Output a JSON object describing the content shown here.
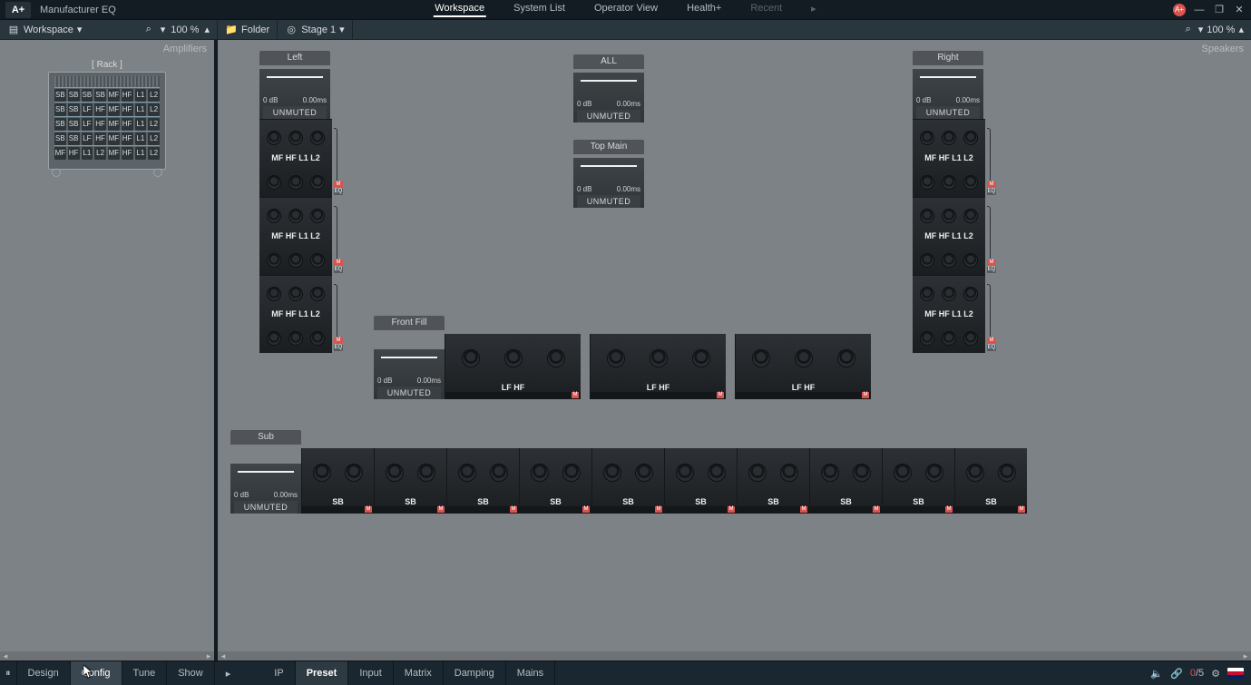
{
  "app": {
    "logo": "A+",
    "name": "Manufacturer EQ"
  },
  "topTabs": {
    "items": [
      "Workspace",
      "System List",
      "Operator View",
      "Health+",
      "Recent"
    ],
    "activeIndex": 0,
    "disabledIndex": 4
  },
  "windowIcons": {
    "badge": "A+",
    "min": "—",
    "restore": "❐",
    "close": "✕",
    "play": "▸"
  },
  "toolbar": {
    "left": {
      "icon": "▤",
      "label": "Workspace",
      "chevron": "▾",
      "search": "⌕",
      "zoomChevron": "▾",
      "zoom": "100 %",
      "zoomArrow": "▴"
    },
    "folder": {
      "icon": "📁",
      "label": "Folder"
    },
    "stage": {
      "icon": "◎",
      "label": "Stage 1",
      "chevron": "▾"
    },
    "right": {
      "search": "⌕",
      "zoomChevron": "▾",
      "zoom": "100 %",
      "zoomArrow": "▴"
    }
  },
  "sidePanel": {
    "title": "Amplifiers"
  },
  "mainPanel": {
    "title": "Speakers"
  },
  "rack": {
    "label": "[ Rack ]",
    "rows": [
      [],
      [
        "SB",
        "SB",
        "SB",
        "SB",
        "MF",
        "HF",
        "L1",
        "L2"
      ],
      [
        "SB",
        "SB",
        "LF",
        "HF",
        "MF",
        "HF",
        "L1",
        "L2"
      ],
      [
        "SB",
        "SB",
        "LF",
        "HF",
        "MF",
        "HF",
        "L1",
        "L2"
      ],
      [
        "SB",
        "SB",
        "LF",
        "HF",
        "MF",
        "HF",
        "L1",
        "L2"
      ],
      [
        "MF",
        "HF",
        "L1",
        "L2",
        "MF",
        "HF",
        "L1",
        "L2"
      ]
    ]
  },
  "groups": {
    "left": {
      "title": "Left",
      "gain": "0 dB",
      "delay": "0.00ms",
      "status": "UNMUTED",
      "modules": [
        "MF HF L1 L2",
        "MF HF L1 L2",
        "MF HF L1 L2"
      ]
    },
    "right": {
      "title": "Right",
      "gain": "0 dB",
      "delay": "0.00ms",
      "status": "UNMUTED",
      "modules": [
        "MF HF L1 L2",
        "MF HF L1 L2",
        "MF HF L1 L2"
      ]
    },
    "all": {
      "title": "ALL",
      "gain": "0 dB",
      "delay": "0.00ms",
      "status": "UNMUTED"
    },
    "topmain": {
      "title": "Top Main",
      "gain": "0 dB",
      "delay": "0.00ms",
      "status": "UNMUTED"
    },
    "frontfill": {
      "title": "Front Fill",
      "gain": "0 dB",
      "delay": "0.00ms",
      "status": "UNMUTED",
      "units": [
        "LF HF",
        "LF HF",
        "LF HF"
      ]
    },
    "sub": {
      "title": "Sub",
      "gain": "0 dB",
      "delay": "0.00ms",
      "status": "UNMUTED",
      "units": [
        "SB",
        "SB",
        "SB",
        "SB",
        "SB",
        "SB",
        "SB",
        "SB",
        "SB",
        "SB"
      ]
    }
  },
  "badges": {
    "m": "M",
    "eq": "EQ"
  },
  "footer": {
    "pause": "⏸",
    "modes": [
      "Design",
      "Config",
      "Tune",
      "Show"
    ],
    "modeActiveIndex": 1,
    "pointer": "▸",
    "views": [
      "IP",
      "Preset",
      "Input",
      "Matrix",
      "Damping",
      "Mains"
    ],
    "viewActiveIndex": 1,
    "right": {
      "speaker": "🔈",
      "link": "🔗",
      "count_n": "0",
      "count_d": "/5",
      "gear": "⚙",
      "flag": "uk"
    }
  }
}
